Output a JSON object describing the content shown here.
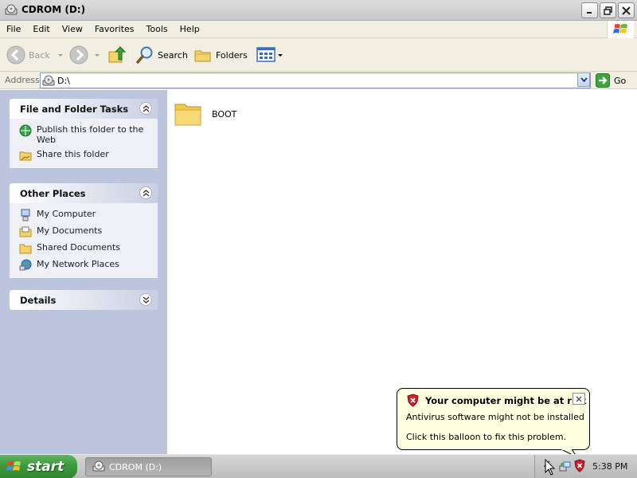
{
  "window": {
    "title": "CDROM (D:)"
  },
  "menu": [
    "File",
    "Edit",
    "View",
    "Favorites",
    "Tools",
    "Help"
  ],
  "toolbar": {
    "back_label": "Back",
    "search_label": "Search",
    "folders_label": "Folders"
  },
  "address": {
    "label": "Address",
    "value": "D:\\",
    "go_label": "Go"
  },
  "tasks_panel": {
    "title": "File and Folder Tasks",
    "items": [
      "Publish this folder to the Web",
      "Share this folder"
    ]
  },
  "places_panel": {
    "title": "Other Places",
    "items": [
      "My Computer",
      "My Documents",
      "Shared Documents",
      "My Network Places"
    ]
  },
  "details_panel": {
    "title": "Details"
  },
  "content": {
    "items": [
      {
        "name": "BOOT",
        "icon": "folder-icon"
      }
    ]
  },
  "balloon": {
    "title": "Your computer might be at risk",
    "line1": "Antivirus software might not be installed",
    "line2": "Click this balloon to fix this problem."
  },
  "taskbar": {
    "start_label": "start",
    "task_label": "CDROM (D:)",
    "clock": "5:38 PM"
  },
  "colors": {
    "task_pane_bg": "#bcc5dd",
    "balloon_bg": "#ffffe1",
    "start_green": "#3c9a3c"
  }
}
